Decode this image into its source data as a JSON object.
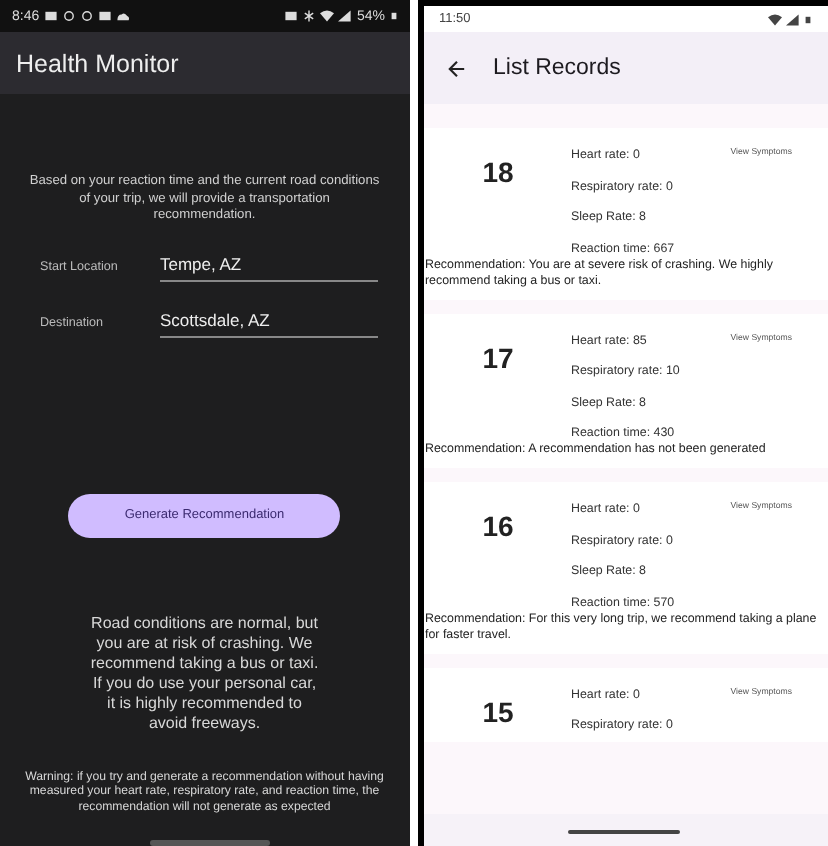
{
  "left_screen": {
    "status_bar": {
      "time": "8:46",
      "battery": "54%"
    },
    "app_bar": {
      "title": "Health Monitor"
    },
    "intro": "Based on your reaction time and the current road conditions of your trip, we will provide a transportation recommendation.",
    "fields": [
      {
        "label": "Start Location",
        "value": "Tempe, AZ"
      },
      {
        "label": "Destination",
        "value": "Scottsdale, AZ"
      }
    ],
    "button": "Generate Recommendation",
    "result": "Road conditions are normal, but you are at risk of crashing. We recommend taking a bus or taxi. If you do use your personal car, it is highly recommended to avoid freeways.",
    "warning": "Warning: if you try and generate a recommendation without having measured your heart rate, respiratory rate, and reaction time, the recommendation will not generate as expected"
  },
  "right_screen": {
    "status_bar": {
      "time": "11:50"
    },
    "app_bar": {
      "title": "List Records"
    },
    "records": [
      {
        "number": "18",
        "link": "View Symptoms",
        "lines": [
          "Heart rate: 0",
          "Respiratory rate: 0",
          "Sleep Rate: 8",
          "Reaction time: 667"
        ],
        "recommendation": "Recommendation: You are at severe risk of crashing. We highly recommend taking a bus or taxi."
      },
      {
        "number": "17",
        "link": "View Symptoms",
        "lines": [
          "Heart rate: 85",
          "Respiratory rate: 10",
          "Sleep Rate: 8",
          "Reaction time: 430"
        ],
        "recommendation": "Recommendation: A recommendation has not been generated"
      },
      {
        "number": "16",
        "link": "View Symptoms",
        "lines": [
          "Heart rate: 0",
          "Respiratory rate: 0",
          "Sleep Rate: 8",
          "Reaction time: 570"
        ],
        "recommendation": "Recommendation: For this very long trip, we recommend taking a plane for faster travel."
      },
      {
        "number": "15",
        "link": "View Symptoms",
        "lines": [
          "Heart rate: 0",
          "Respiratory rate: 0"
        ]
      }
    ]
  }
}
